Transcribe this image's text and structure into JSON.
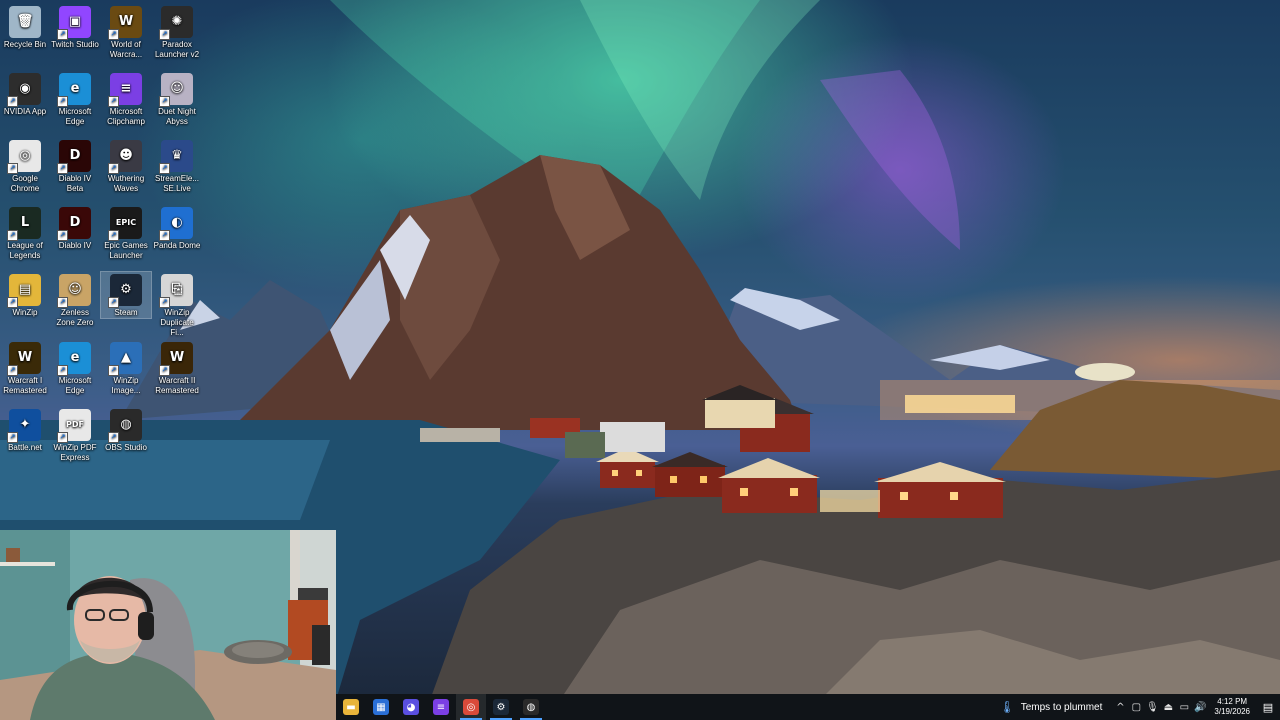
{
  "desktop_icons": [
    {
      "label": "Recycle Bin",
      "icon": "recycle-bin-icon",
      "color": "#9fb6c8",
      "glyph": "🗑",
      "shortcut": false
    },
    {
      "label": "Twitch Studio",
      "icon": "twitch-studio-icon",
      "color": "#9146ff",
      "glyph": "▣",
      "shortcut": true
    },
    {
      "label": "World of Warcra...",
      "icon": "world-of-warcraft-icon",
      "color": "#6a4a12",
      "glyph": "W",
      "shortcut": true
    },
    {
      "label": "Paradox Launcher v2",
      "icon": "paradox-launcher-icon",
      "color": "#2b2b2b",
      "glyph": "✺",
      "shortcut": true
    },
    {
      "label": "NVIDIA App",
      "icon": "nvidia-app-icon",
      "color": "#2d2d2d",
      "glyph": "◉",
      "shortcut": true
    },
    {
      "label": "Microsoft Edge",
      "icon": "microsoft-edge-icon",
      "color": "#1b8fd6",
      "glyph": "e",
      "shortcut": true
    },
    {
      "label": "Microsoft Clipchamp",
      "icon": "clipchamp-icon",
      "color": "#7b3fe4",
      "glyph": "≡",
      "shortcut": true
    },
    {
      "label": "Duet Night Abyss",
      "icon": "duet-night-abyss-icon",
      "color": "#b8b2c4",
      "glyph": "☺",
      "shortcut": true
    },
    {
      "label": "Google Chrome",
      "icon": "google-chrome-icon",
      "color": "#e8e8e8",
      "glyph": "◎",
      "shortcut": true
    },
    {
      "label": "Diablo IV Beta",
      "icon": "diablo-iv-beta-icon",
      "color": "#2a0606",
      "glyph": "D",
      "shortcut": true
    },
    {
      "label": "Wuthering Waves",
      "icon": "wuthering-waves-icon",
      "color": "#3a3a44",
      "glyph": "☻",
      "shortcut": true
    },
    {
      "label": "StreamEle... SE.Live",
      "icon": "streamelements-icon",
      "color": "#2b4a8a",
      "glyph": "♛",
      "shortcut": true
    },
    {
      "label": "League of Legends",
      "icon": "league-of-legends-icon",
      "color": "#1a2a22",
      "glyph": "L",
      "shortcut": true
    },
    {
      "label": "Diablo IV",
      "icon": "diablo-iv-icon",
      "color": "#3a0808",
      "glyph": "D",
      "shortcut": true
    },
    {
      "label": "Epic Games Launcher",
      "icon": "epic-games-icon",
      "color": "#1a1a1a",
      "glyph": "EPIC",
      "shortcut": true
    },
    {
      "label": "Panda Dome",
      "icon": "panda-dome-icon",
      "color": "#1f6fd1",
      "glyph": "◐",
      "shortcut": true
    },
    {
      "label": "WinZip",
      "icon": "winzip-icon",
      "color": "#e3b63a",
      "glyph": "▤",
      "shortcut": true
    },
    {
      "label": "Zenless Zone Zero",
      "icon": "zenless-zone-zero-icon",
      "color": "#c9a466",
      "glyph": "☺",
      "shortcut": true
    },
    {
      "label": "Steam",
      "icon": "steam-icon",
      "color": "#1b2838",
      "glyph": "⚙",
      "shortcut": true,
      "selected": true
    },
    {
      "label": "WinZip Duplicate Fi...",
      "icon": "winzip-duplicate-finder-icon",
      "color": "#d6d6d6",
      "glyph": "⎘",
      "shortcut": true
    },
    {
      "label": "Warcraft I Remastered",
      "icon": "warcraft-i-remastered-icon",
      "color": "#3a2a08",
      "glyph": "W",
      "shortcut": true
    },
    {
      "label": "Microsoft Edge",
      "icon": "microsoft-edge-icon",
      "color": "#1b8fd6",
      "glyph": "e",
      "shortcut": true
    },
    {
      "label": "WinZip Image...",
      "icon": "winzip-image-manager-icon",
      "color": "#2b6fb8",
      "glyph": "▲",
      "shortcut": true
    },
    {
      "label": "Warcraft II Remastered",
      "icon": "warcraft-ii-remastered-icon",
      "color": "#3a2608",
      "glyph": "W",
      "shortcut": true
    },
    {
      "label": "Battle.net",
      "icon": "battle-net-icon",
      "color": "#0f4f9e",
      "glyph": "✦",
      "shortcut": true
    },
    {
      "label": "WinZip PDF Express",
      "icon": "winzip-pdf-express-icon",
      "color": "#e8e8e8",
      "glyph": "PDF",
      "shortcut": true
    },
    {
      "label": "OBS Studio",
      "icon": "obs-studio-icon",
      "color": "#2a2a2a",
      "glyph": "◍",
      "shortcut": true
    }
  ],
  "taskbar": {
    "apps": [
      {
        "name": "file-explorer-icon",
        "color": "#e8b43a",
        "glyph": "▬",
        "state": "normal"
      },
      {
        "name": "store-icon",
        "color": "#2a6fd6",
        "glyph": "▦",
        "state": "normal"
      },
      {
        "name": "discord-icon",
        "color": "#5a4fe0",
        "glyph": "◕",
        "state": "normal"
      },
      {
        "name": "clipchamp-taskbar-icon",
        "color": "#7b3fe4",
        "glyph": "≡",
        "state": "normal"
      },
      {
        "name": "google-chrome-taskbar-icon",
        "color": "#d94a3a",
        "glyph": "◎",
        "state": "active"
      },
      {
        "name": "steam-taskbar-icon",
        "color": "#1b2838",
        "glyph": "⚙",
        "state": "running"
      },
      {
        "name": "obs-studio-taskbar-icon",
        "color": "#2a2a2a",
        "glyph": "◍",
        "state": "running"
      }
    ],
    "weather_text": "Temps to plummet",
    "weather_icon": "thermometer-icon",
    "tray_icons": [
      {
        "name": "show-hidden-icons-chevron",
        "glyph": "^"
      },
      {
        "name": "meet-now-icon",
        "glyph": "▢"
      },
      {
        "name": "microphone-icon",
        "glyph": "🎙"
      },
      {
        "name": "usb-device-icon",
        "glyph": "⏏"
      },
      {
        "name": "network-icon",
        "glyph": "▭"
      },
      {
        "name": "volume-icon",
        "glyph": "🔊"
      }
    ],
    "time": "4:12 PM",
    "date": "3/19/2026",
    "notification_icon": "notification-center-icon"
  },
  "colors": {
    "taskbar_bg": "#101418",
    "accent": "#4ea1ff"
  }
}
